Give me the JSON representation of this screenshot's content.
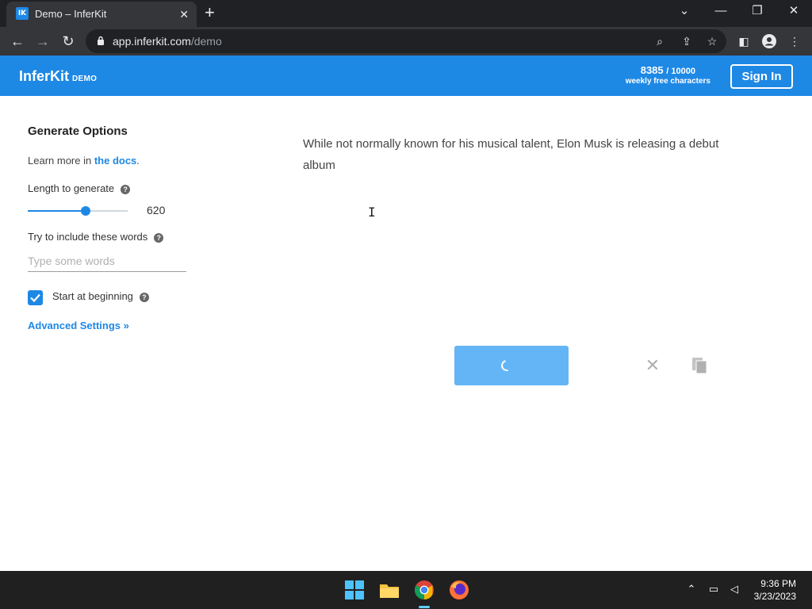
{
  "browser": {
    "tab": {
      "favicon_text": "IK",
      "title": "Demo – InferKit"
    },
    "url_host": "app.inferkit.com",
    "url_path": "/demo"
  },
  "header": {
    "brand": "InferKit",
    "brand_sub": "DEMO",
    "quota_used": "8385",
    "quota_total": "/ 10000",
    "quota_label": "weekly free characters",
    "signin_label": "Sign In",
    "accent_color": "#1e88e5"
  },
  "sidebar": {
    "title": "Generate Options",
    "learn_prefix": "Learn more in ",
    "learn_link": "the docs",
    "learn_suffix": ".",
    "length_label": "Length to generate",
    "length_value": "620",
    "length_fraction": 0.58,
    "words_label": "Try to include these words",
    "words_placeholder": "Type some words",
    "start_label": "Start at beginning",
    "start_checked": true,
    "advanced_label": "Advanced Settings »",
    "help_glyph": "?"
  },
  "main": {
    "prompt": "While not normally known for his musical talent, Elon Musk is releasing a debut album"
  },
  "taskbar": {
    "time": "9:36 PM",
    "date": "3/23/2023"
  }
}
